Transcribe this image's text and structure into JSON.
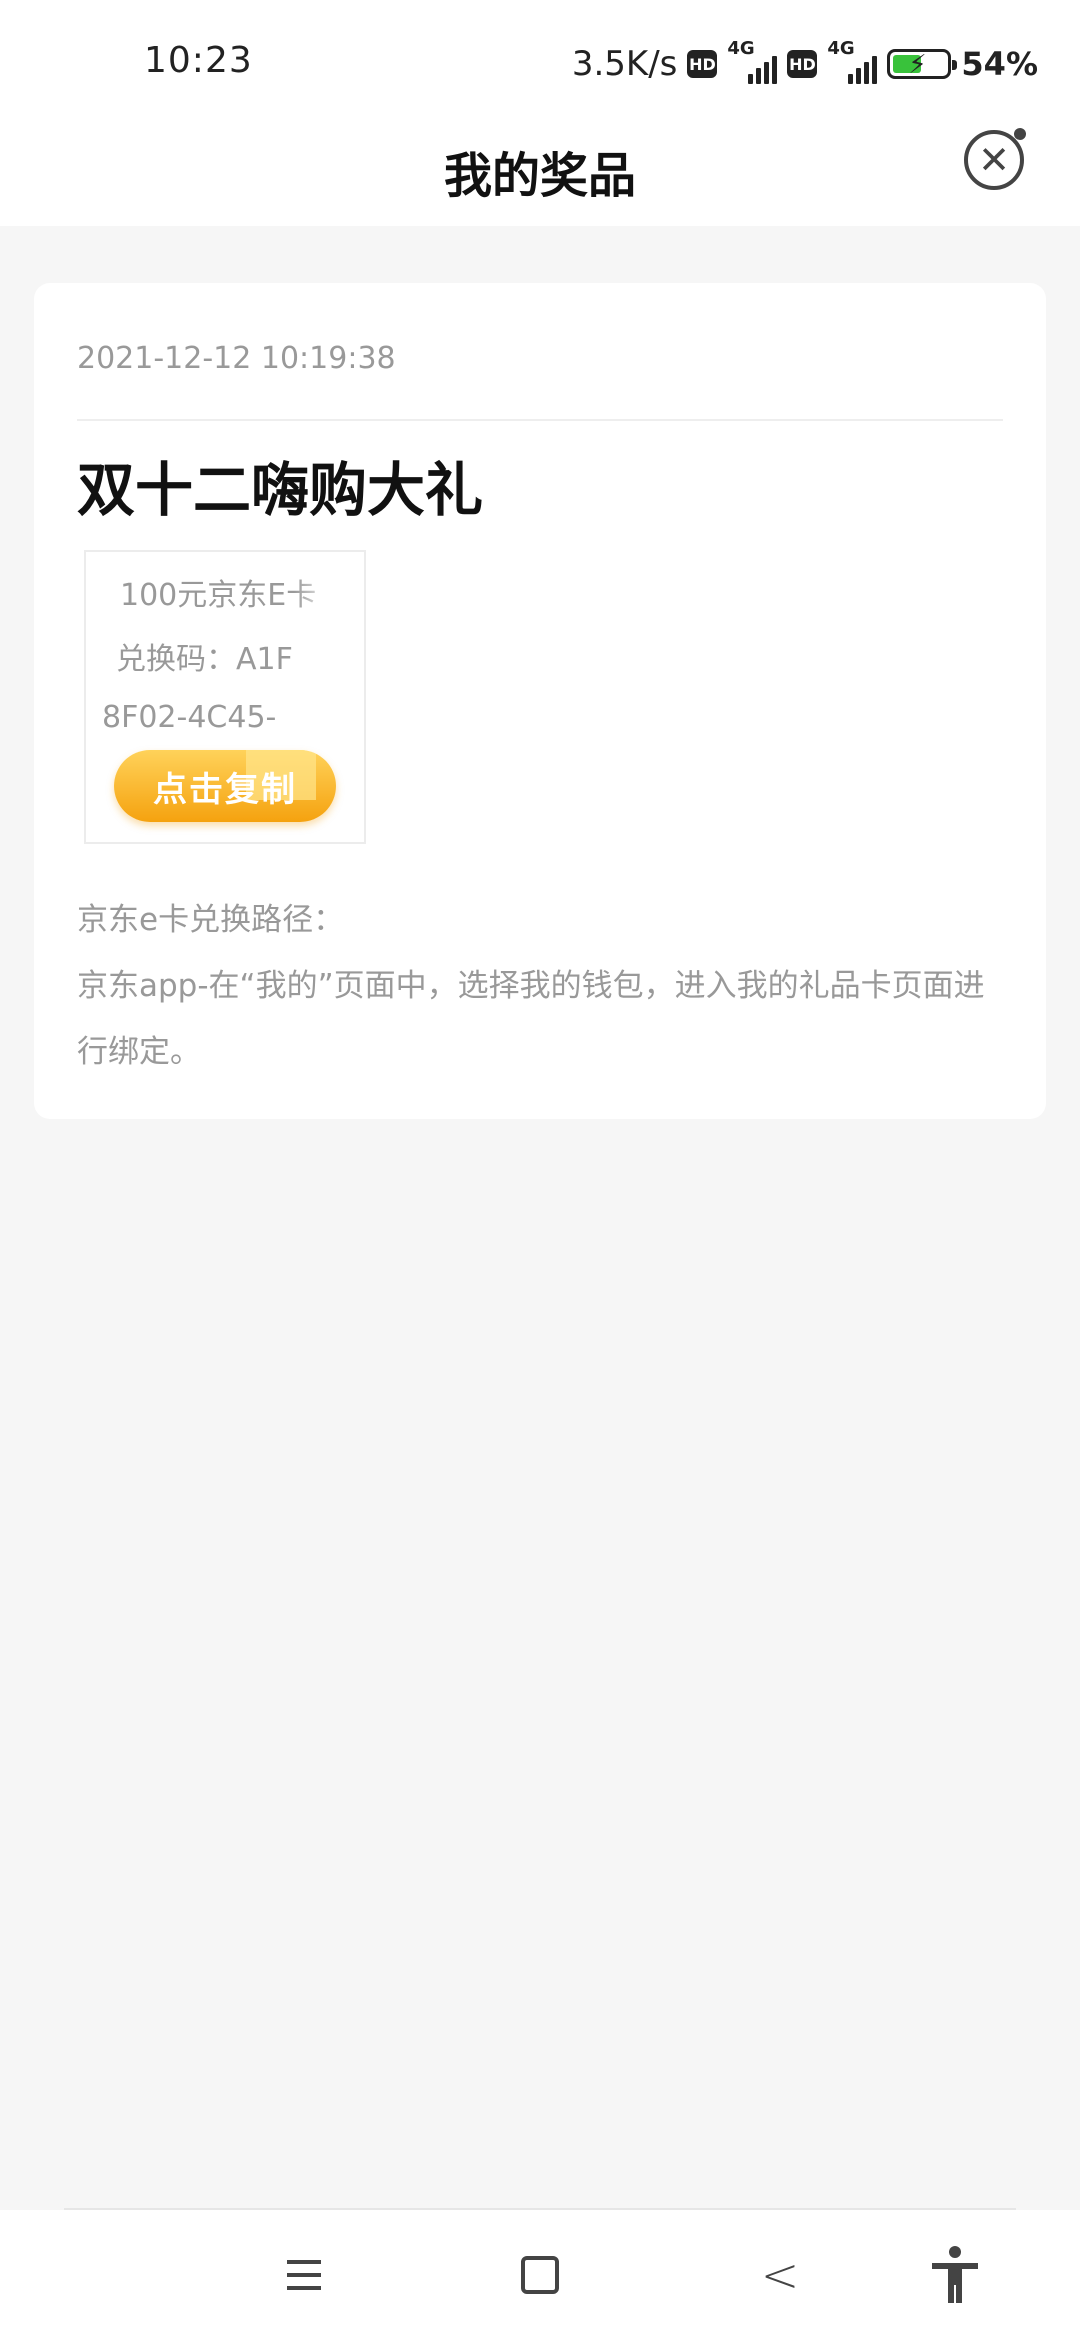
{
  "status_bar": {
    "time": "10:23",
    "net_speed": "3.5K/s",
    "hd_label": "HD",
    "network_label": "4G",
    "battery_pct": "54%",
    "battery_level": 0.54
  },
  "header": {
    "title": "我的奖品"
  },
  "prize_card": {
    "timestamp": "2021-12-12 10:19:38",
    "title": "双十二嗨购大礼",
    "prize_lines": [
      "100元京东E卡",
      "兑换码：A1F",
      "8F02-4C45-"
    ],
    "copy_button_label": "点击复制",
    "path_title": "京东e卡兑换路径：",
    "path_body": "京东app-在“我的”页面中，选择我的钱包，进入我的礼品卡页面进行绑定。"
  },
  "colors": {
    "accent": "#f5a20f",
    "muted_text": "#999999",
    "battery": "#39c23b"
  },
  "icons": {
    "close": "close-circle-icon",
    "menu": "menu-icon",
    "home": "home-icon",
    "back": "back-icon",
    "accessibility": "accessibility-icon"
  }
}
